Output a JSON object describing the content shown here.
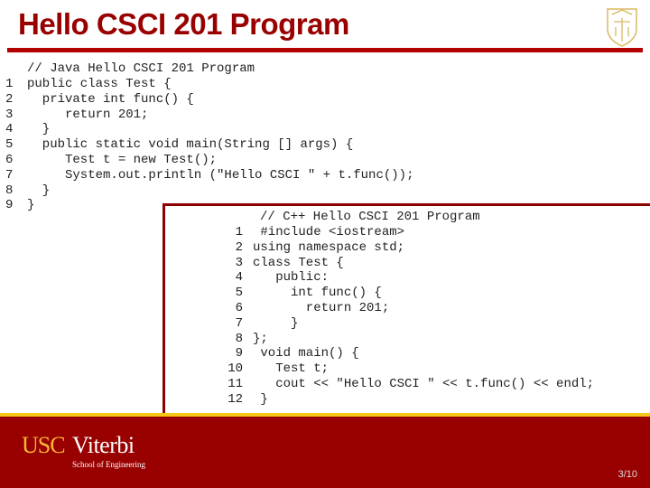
{
  "slide": {
    "title": "Hello CSCI 201 Program",
    "page_number": "3/10",
    "colors": {
      "title": "#990000",
      "footer": "#990000",
      "accent_gold": "#f5c518"
    }
  },
  "java": {
    "header": "// Java Hello CSCI 201 Program",
    "line_numbers": "1\n2\n3\n4\n5\n6\n7\n8\n9",
    "code": "public class Test {\n  private int func() {\n     return 201;\n  }\n  public static void main(String [] args) {\n     Test t = new Test();\n     System.out.println (\"Hello CSCI \" + t.func());\n  }\n}"
  },
  "cpp": {
    "header": "// C++ Hello CSCI 201 Program",
    "line_numbers": "1\n2\n3\n4\n5\n6\n7\n8\n9\n10\n11\n12",
    "code": " #include <iostream>\nusing namespace std;\nclass Test {\n   public:\n     int func() {\n       return 201;\n     }\n};\n void main() {\n   Test t;\n   cout << \"Hello CSCI \" << t.func() << endl;\n }"
  },
  "footer": {
    "logo_usc": "USC",
    "logo_viterbi": "Viterbi",
    "logo_sub": "School of Engineering"
  }
}
